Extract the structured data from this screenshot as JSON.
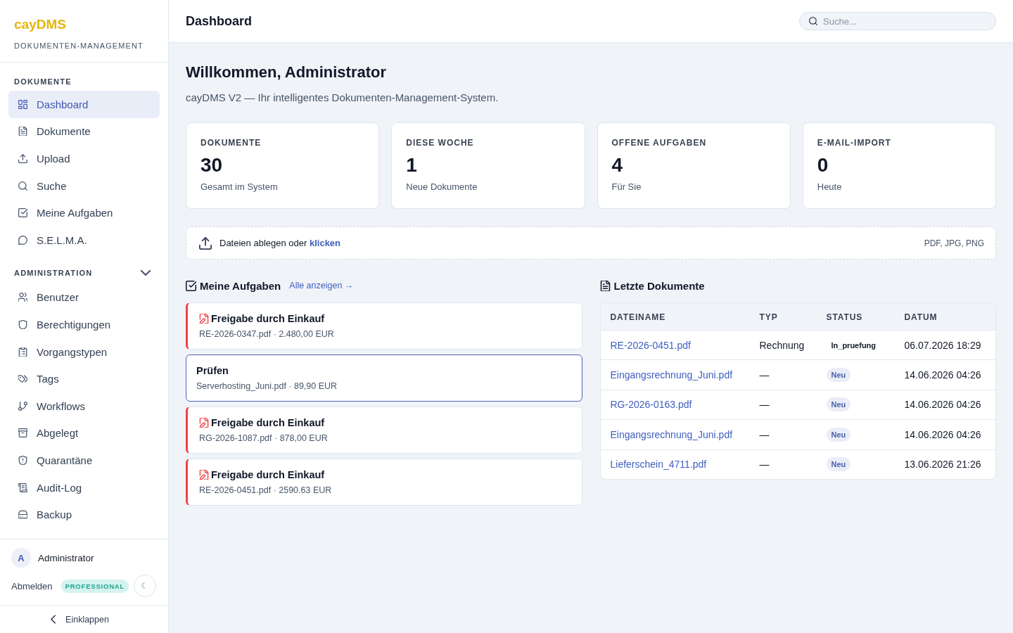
{
  "sidebar": {
    "brand": {
      "name": "cayDMS",
      "tagline": "DOKUMENTEN-MANAGEMENT"
    },
    "sections": [
      {
        "title": "DOKUMENTE",
        "collapsible": false,
        "expanded": true,
        "items": [
          {
            "label": "Dashboard",
            "selected": true
          },
          {
            "label": "Dokumente",
            "selected": false
          },
          {
            "label": "Upload",
            "selected": false
          },
          {
            "label": "Suche",
            "selected": false
          },
          {
            "label": "Meine Aufgaben",
            "selected": false
          },
          {
            "label": "S.E.L.M.A.",
            "selected": false
          }
        ]
      },
      {
        "title": "ADMINISTRATION",
        "collapsible": true,
        "expanded": true,
        "items": [
          {
            "label": "Benutzer",
            "selected": false
          },
          {
            "label": "Berechtigungen",
            "selected": false
          },
          {
            "label": "Vorgangstypen",
            "selected": false
          },
          {
            "label": "Tags",
            "selected": false
          },
          {
            "label": "Workflows",
            "selected": false
          },
          {
            "label": "Abgelegt",
            "selected": false
          },
          {
            "label": "Quarantäne",
            "selected": false
          },
          {
            "label": "Audit-Log",
            "selected": false
          },
          {
            "label": "Backup",
            "selected": false
          }
        ]
      }
    ],
    "user": {
      "initial": "A",
      "name": "Administrator"
    },
    "logout": "Abmelden",
    "plan_badge": "PROFESSIONAL",
    "theme_toggle": "☾",
    "collapse": "Einklappen"
  },
  "header": {
    "title": "Dashboard",
    "search": {
      "placeholder": "Suche..."
    }
  },
  "welcome": {
    "title": "Willkommen, Administrator",
    "subtitle": "cayDMS V2 — Ihr intelligentes Dokumenten-Management-System."
  },
  "stats": [
    {
      "label": "DOKUMENTE",
      "value": "30",
      "caption": "Gesamt im System"
    },
    {
      "label": "DIESE WOCHE",
      "value": "1",
      "caption": "Neue Dokumente"
    },
    {
      "label": "OFFENE AUFGABEN",
      "value": "4",
      "caption": "Für Sie"
    },
    {
      "label": "E-MAIL-IMPORT",
      "value": "0",
      "caption": "Heute"
    }
  ],
  "upload": {
    "prompt": "Dateien ablegen oder",
    "link": "klicken",
    "formats": "PDF, JPG, PNG"
  },
  "tasks": {
    "title": "Meine Aufgaben",
    "link": "Alle anzeigen →",
    "items": [
      {
        "kind": "approval",
        "title": "Freigabe durch Einkauf",
        "detail": "RE-2026-0347.pdf · 2.480,00 EUR",
        "selected": false
      },
      {
        "kind": "review",
        "title": "Prüfen",
        "detail": "Serverhosting_Juni.pdf · 89,90 EUR",
        "selected": true
      },
      {
        "kind": "approval",
        "title": "Freigabe durch Einkauf",
        "detail": "RG-2026-1087.pdf · 878,00 EUR",
        "selected": false
      },
      {
        "kind": "approval",
        "title": "Freigabe durch Einkauf",
        "detail": "RE-2026-0451.pdf · 2590.63 EUR",
        "selected": false
      }
    ]
  },
  "recent": {
    "title": "Letzte Dokumente",
    "columns": [
      "DATEINAME",
      "TYP",
      "STATUS",
      "DATUM"
    ],
    "rows": [
      {
        "file": "RE-2026-0451.pdf",
        "type": "Rechnung",
        "status": {
          "label": "In_pruefung",
          "kind": "in_review"
        },
        "date": "06.07.2026 18:29"
      },
      {
        "file": "Eingangsrechnung_Juni.pdf",
        "type": "—",
        "status": {
          "label": "Neu",
          "kind": "new"
        },
        "date": "14.06.2026 04:26"
      },
      {
        "file": "RG-2026-0163.pdf",
        "type": "—",
        "status": {
          "label": "Neu",
          "kind": "new"
        },
        "date": "14.06.2026 04:26"
      },
      {
        "file": "Eingangsrechnung_Juni.pdf",
        "type": "—",
        "status": {
          "label": "Neu",
          "kind": "new"
        },
        "date": "14.06.2026 04:26"
      },
      {
        "file": "Lieferschein_4711.pdf",
        "type": "—",
        "status": {
          "label": "Neu",
          "kind": "new"
        },
        "date": "13.06.2026 21:26"
      }
    ]
  }
}
